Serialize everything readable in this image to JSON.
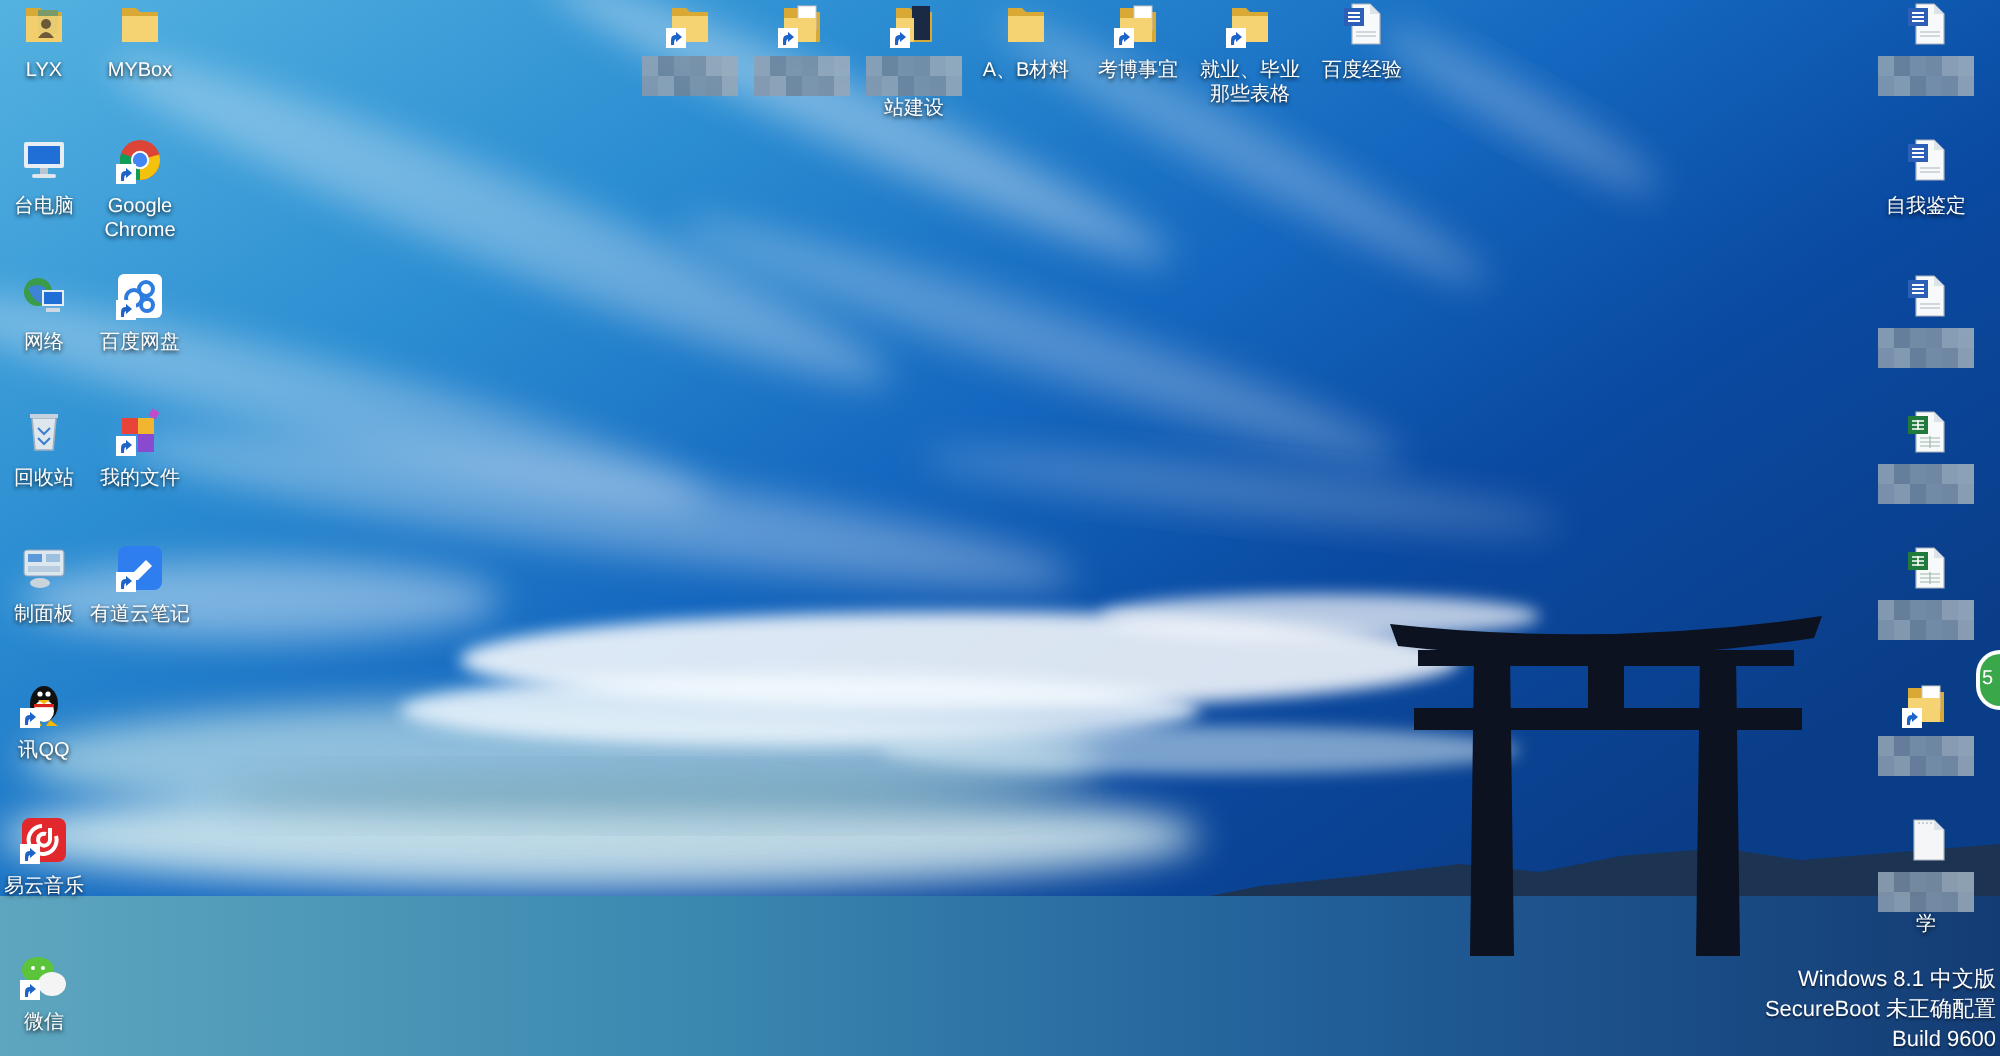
{
  "desktop": {
    "left_columns": [
      [
        {
          "kind": "folder-person",
          "shortcut": false,
          "blurred": false,
          "label": "LYX"
        },
        {
          "kind": "computer",
          "shortcut": false,
          "blurred": false,
          "label": "台电脑"
        },
        {
          "kind": "network",
          "shortcut": false,
          "blurred": false,
          "label": "网络"
        },
        {
          "kind": "recycle-bin",
          "shortcut": false,
          "blurred": false,
          "label": "回收站"
        },
        {
          "kind": "control-panel",
          "shortcut": false,
          "blurred": false,
          "label": "制面板"
        },
        {
          "kind": "qq",
          "shortcut": true,
          "blurred": false,
          "label": "讯QQ"
        },
        {
          "kind": "netease",
          "shortcut": true,
          "blurred": false,
          "label": "易云音乐"
        },
        {
          "kind": "wechat",
          "shortcut": true,
          "blurred": false,
          "label": "微信"
        }
      ],
      [
        {
          "kind": "folder",
          "shortcut": false,
          "blurred": false,
          "label": "MYBox"
        },
        {
          "kind": "chrome",
          "shortcut": true,
          "blurred": false,
          "label": "Google Chrome"
        },
        {
          "kind": "baidu-pan",
          "shortcut": true,
          "blurred": false,
          "label": "百度网盘"
        },
        {
          "kind": "my-files",
          "shortcut": true,
          "blurred": false,
          "label": "我的文件"
        },
        {
          "kind": "youdao",
          "shortcut": true,
          "blurred": false,
          "label": "有道云笔记"
        }
      ]
    ],
    "top_row": [
      {
        "kind": "folder",
        "shortcut": true,
        "blurred": true
      },
      {
        "kind": "folder-document",
        "shortcut": true,
        "blurred": true
      },
      {
        "kind": "folder-photo",
        "shortcut": true,
        "blurred": true,
        "label": "站建设"
      },
      {
        "kind": "folder",
        "shortcut": false,
        "blurred": false,
        "label": "A、B材料"
      },
      {
        "kind": "folder-document",
        "shortcut": true,
        "blurred": false,
        "label": "考博事宜"
      },
      {
        "kind": "folder",
        "shortcut": true,
        "blurred": false,
        "label": "就业、毕业那些表格"
      },
      {
        "kind": "word",
        "shortcut": false,
        "blurred": false,
        "label": "百度经验"
      }
    ],
    "right_column": [
      {
        "kind": "word",
        "shortcut": false,
        "blurred": true
      },
      {
        "kind": "word",
        "shortcut": false,
        "blurred": false,
        "label": "自我鉴定"
      },
      {
        "kind": "word",
        "shortcut": false,
        "blurred": true
      },
      {
        "kind": "excel",
        "shortcut": false,
        "blurred": true
      },
      {
        "kind": "excel",
        "shortcut": false,
        "blurred": true
      },
      {
        "kind": "folder-document",
        "shortcut": true,
        "blurred": true
      },
      {
        "kind": "blank-file",
        "shortcut": false,
        "blurred": true,
        "label": "学"
      }
    ]
  },
  "floating_ball": {
    "text": "5"
  },
  "system_watermark": {
    "lines": [
      "Windows 8.1 中文版",
      "SecureBoot 未正确配置",
      "Build 9600"
    ]
  }
}
